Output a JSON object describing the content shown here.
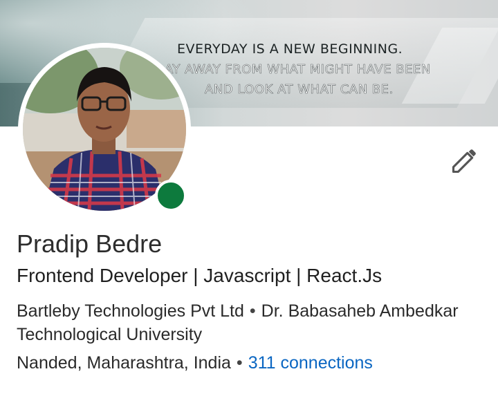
{
  "banner": {
    "quote_line1": "EVERYDAY IS A NEW BEGINNING.",
    "quote_line2": "AY AWAY FROM WHAT MIGHT HAVE BEEN",
    "quote_line3": "AND LOOK AT WHAT CAN BE."
  },
  "profile": {
    "name": "Pradip Bedre",
    "headline": "Frontend Developer | Javascript | React.Js",
    "company": "Bartleby Technologies Pvt Ltd",
    "separator": "•",
    "school": "Dr. Babasaheb Ambedkar Technological University",
    "location": "Nanded, Maharashtra, India",
    "connections": "311 connections",
    "online_status_color": "#0d7a3d"
  },
  "icons": {
    "edit": "pencil-icon"
  },
  "colors": {
    "link": "#0a66c2",
    "text": "#2a2a2a"
  }
}
